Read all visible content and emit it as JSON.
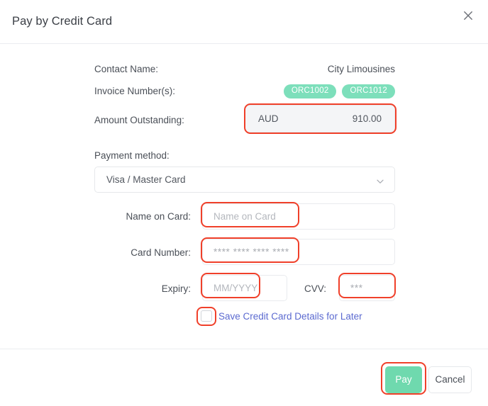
{
  "dialog": {
    "title": "Pay by Credit Card",
    "close_icon": "close-icon"
  },
  "summary": {
    "contact_label": "Contact Name:",
    "contact_value": "City Limousines",
    "invoice_label": "Invoice Number(s):",
    "invoices": [
      "ORC1002",
      "ORC1012"
    ],
    "amount_label": "Amount Outstanding:",
    "amount_currency": "AUD",
    "amount_value": "910.00"
  },
  "payment_method": {
    "label": "Payment method:",
    "selected": "Visa / Master Card",
    "chevron_icon": "chevron-down-icon"
  },
  "card_form": {
    "name_label": "Name on Card:",
    "name_placeholder": "Name on Card",
    "name_value": "",
    "number_label": "Card Number:",
    "number_placeholder": "**** **** **** ****",
    "number_value": "",
    "expiry_label": "Expiry:",
    "expiry_placeholder": "MM/YYYY",
    "expiry_value": "",
    "cvv_label": "CVV:",
    "cvv_placeholder": "***",
    "cvv_value": "",
    "save_label": "Save Credit Card Details for Later",
    "save_checked": false
  },
  "footer": {
    "pay_label": "Pay",
    "cancel_label": "Cancel"
  },
  "colors": {
    "badge_green": "#7ddfbb",
    "pay_green": "#6fd9ae",
    "link_blue": "#5b6ad0",
    "annotation_red": "#f0402a",
    "amount_fill": "#f4f5f7"
  }
}
